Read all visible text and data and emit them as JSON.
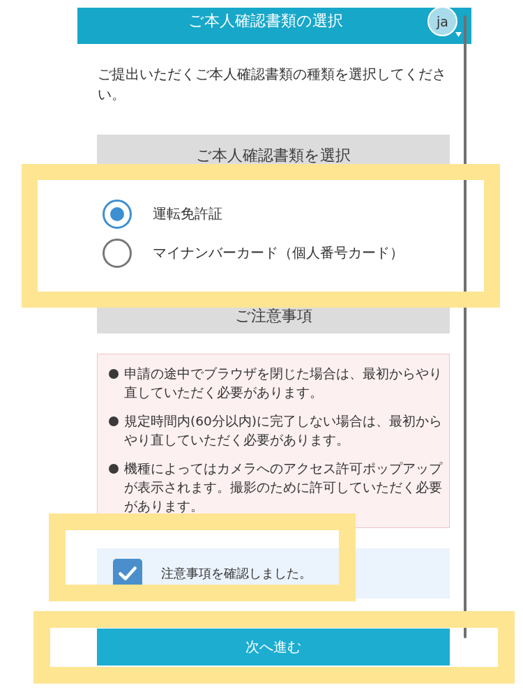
{
  "header": {
    "title": "ご本人確認書類の選択",
    "language": "ja"
  },
  "intro": "ご提出いただくご本人確認書類の種類を選択してください。",
  "document_select": {
    "heading": "ご本人確認書類を選択",
    "highlighted": true,
    "options": [
      {
        "label": "運転免許証",
        "selected": true
      },
      {
        "label": "マイナンバーカード（個人番号カード）",
        "selected": false
      }
    ]
  },
  "notice": {
    "heading": "ご注意事項",
    "items": [
      "申請の途中でブラウザを閉じた場合は、最初からやり直していただく必要があります。",
      "規定時間内(60分以内)に完了しない場合は、最初からやり直していただく必要があります。",
      "機種によってはカメラへのアクセス許可ポップアップが表示されます。撮影のために許可していただく必要があります。"
    ]
  },
  "confirmation": {
    "label": "注意事項を確認しました。",
    "checked": true,
    "highlighted": true
  },
  "next_button": {
    "label": "次へ進む",
    "highlighted": true
  }
}
